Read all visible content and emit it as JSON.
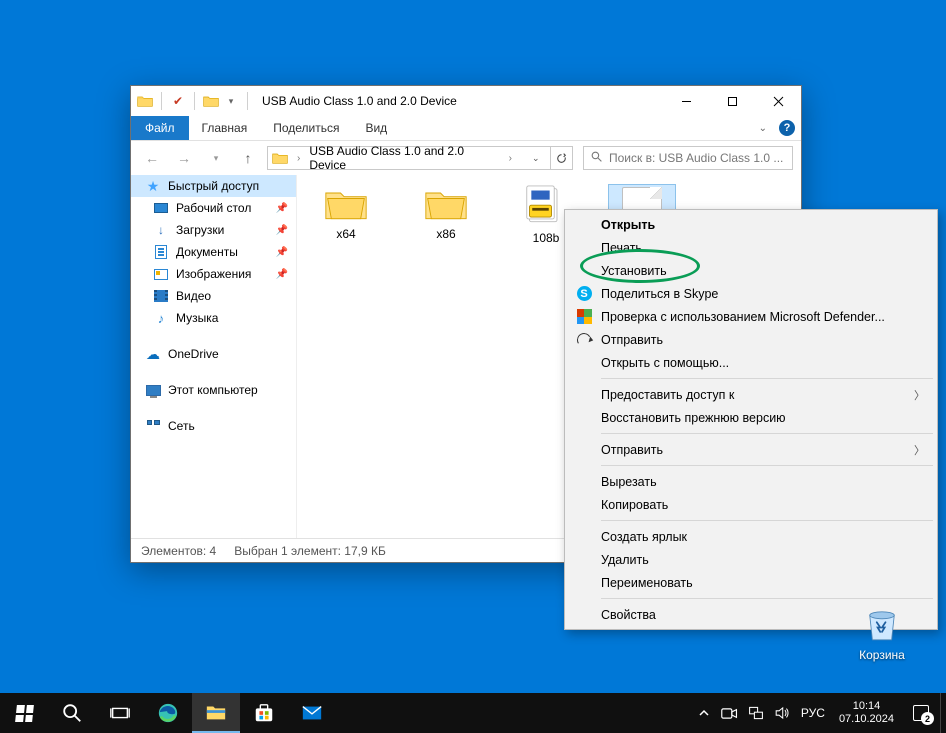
{
  "window": {
    "title": "USB Audio Class 1.0 and 2.0 Device",
    "menu": {
      "file": "Файл",
      "home": "Главная",
      "share": "Поделиться",
      "view": "Вид"
    },
    "address": {
      "folder": "USB Audio Class 1.0 and 2.0 Device"
    },
    "search": {
      "placeholder": "Поиск в: USB Audio Class 1.0 ..."
    },
    "statusbar": {
      "count": "Элементов: 4",
      "selection": "Выбран 1 элемент: 17,9 КБ"
    }
  },
  "nav": {
    "quick": "Быстрый доступ",
    "desktop": "Рабочий стол",
    "downloads": "Загрузки",
    "documents": "Документы",
    "pictures": "Изображения",
    "videos": "Видео",
    "music": "Музыка",
    "onedrive": "OneDrive",
    "thispc": "Этот компьютер",
    "network": "Сеть"
  },
  "files": {
    "x64": "x64",
    "x86": "x86",
    "cab": "108b"
  },
  "ctx": {
    "open": "Открыть",
    "print": "Печать",
    "install": "Установить",
    "skype": "Поделиться в Skype",
    "defender": "Проверка с использованием Microsoft Defender...",
    "send": "Отправить",
    "openwith": "Открыть с помощью...",
    "grant": "Предоставить доступ к",
    "restore": "Восстановить прежнюю версию",
    "sendto": "Отправить",
    "cut": "Вырезать",
    "copy": "Копировать",
    "shortcut": "Создать ярлык",
    "delete": "Удалить",
    "rename": "Переименовать",
    "props": "Свойства"
  },
  "desktop": {
    "recycle": "Корзина"
  },
  "tray": {
    "lang": "РУС",
    "time": "10:14",
    "date": "07.10.2024",
    "notif_count": "2"
  }
}
